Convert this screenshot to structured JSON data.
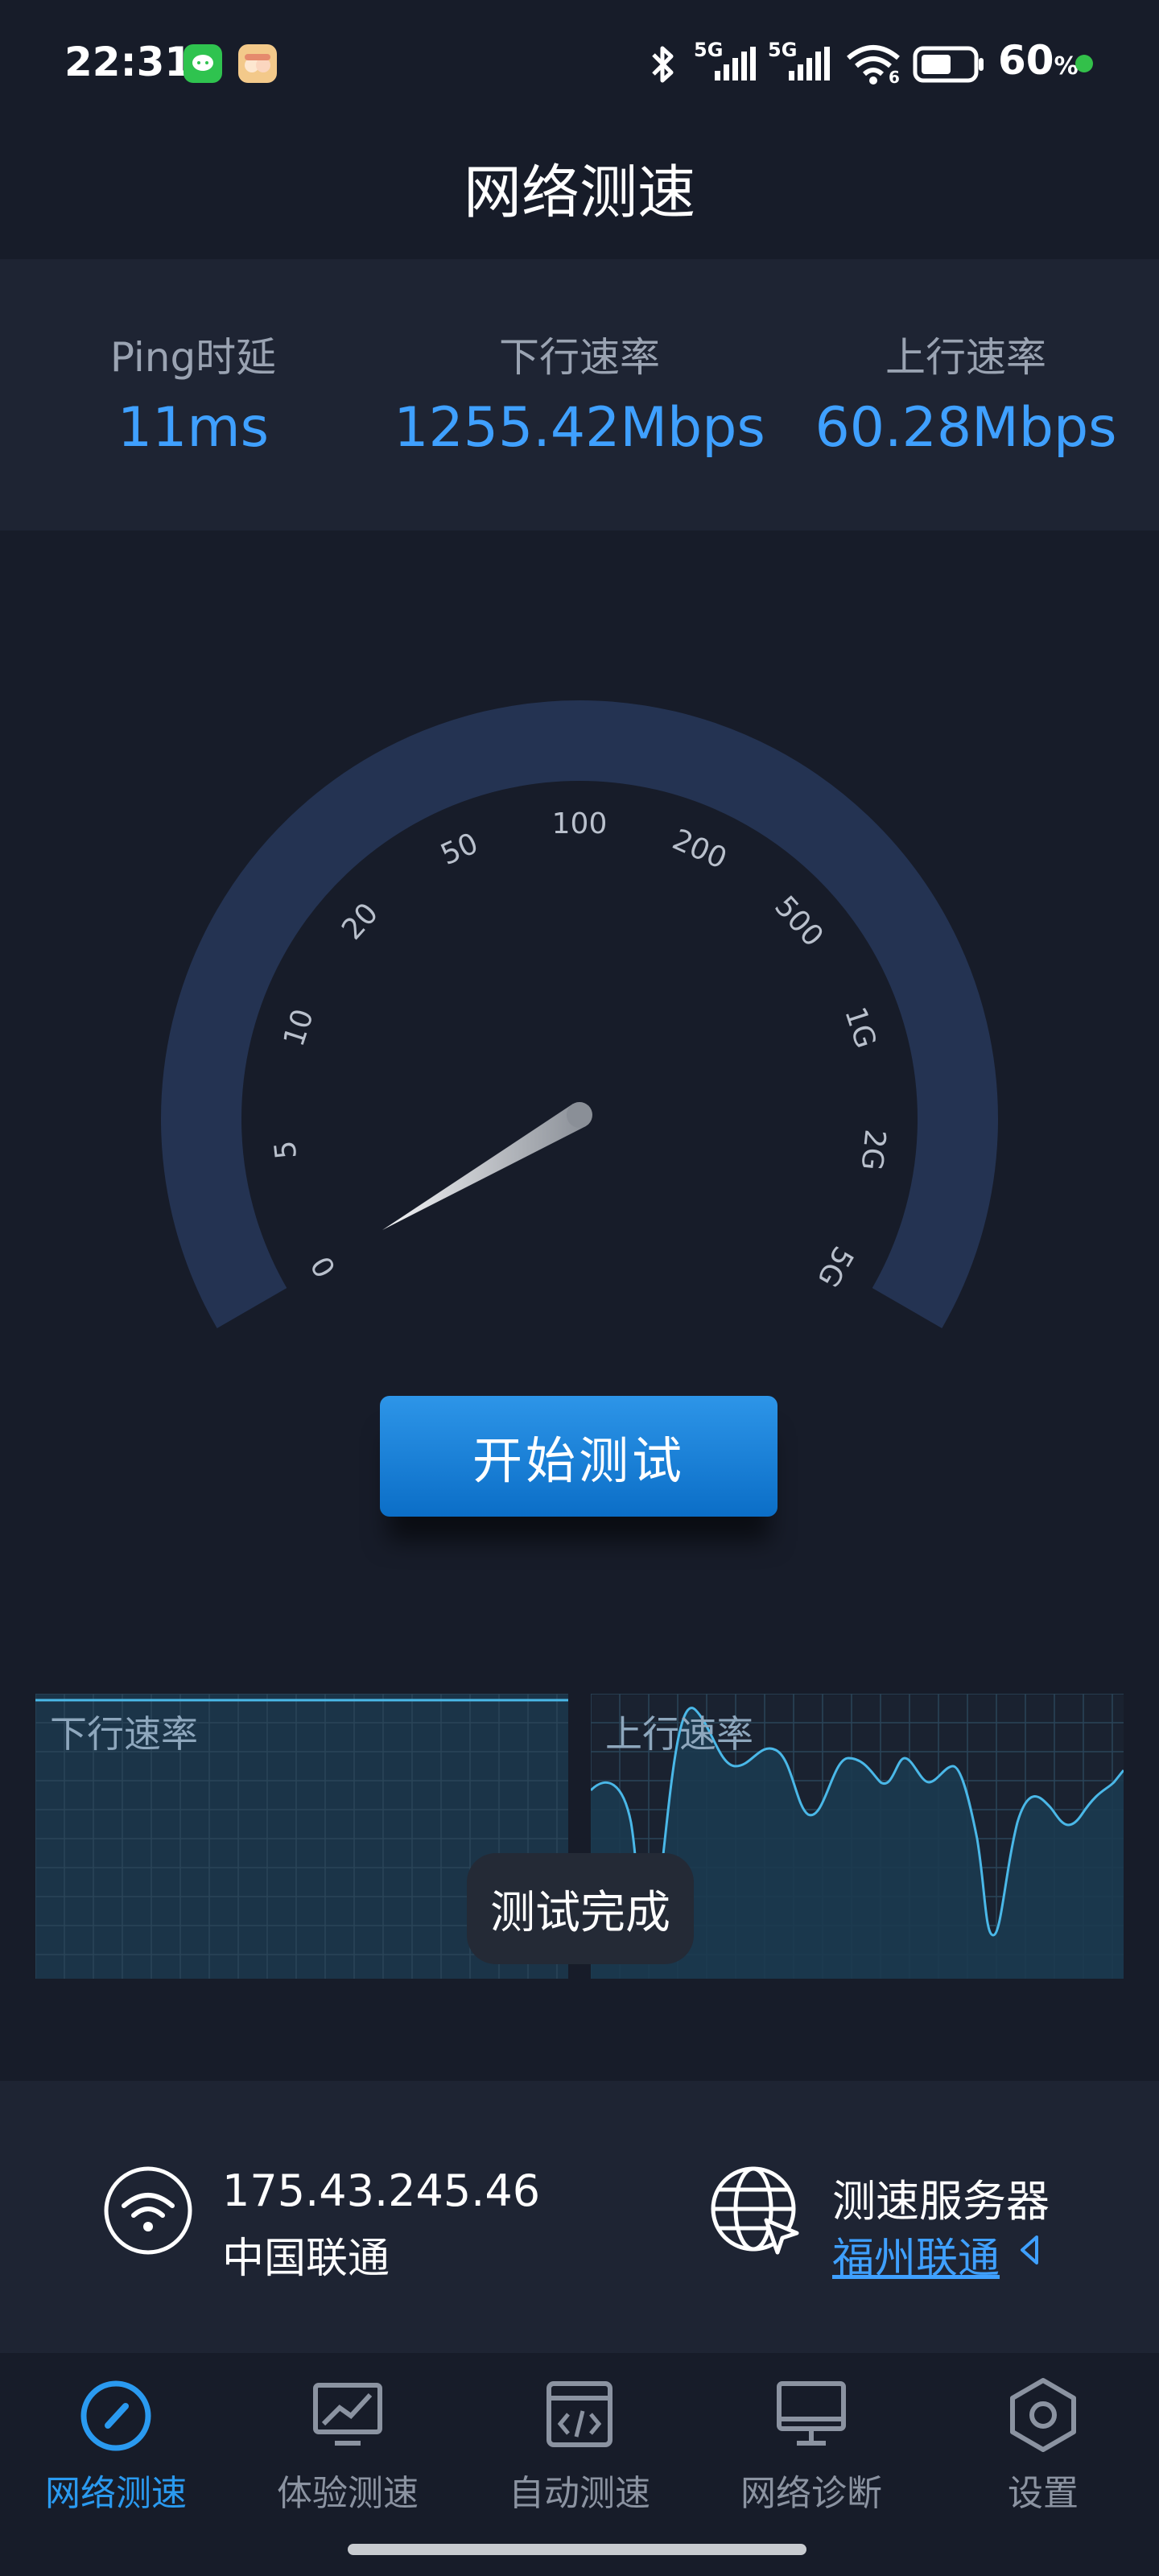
{
  "status_bar": {
    "time": "22:31",
    "battery_percent": "60",
    "battery_unit": "%",
    "net1": "5G",
    "net2": "5G",
    "wifi_sub": "6"
  },
  "title": "网络测速",
  "stats": [
    {
      "label": "Ping时延",
      "value": "11ms"
    },
    {
      "label": "下行速率",
      "value": "1255.42Mbps"
    },
    {
      "label": "上行速率",
      "value": "60.28Mbps"
    }
  ],
  "gauge": {
    "scale_labels": [
      "0",
      "5",
      "10",
      "20",
      "50",
      "100",
      "200",
      "500",
      "1G",
      "2G",
      "5G"
    ],
    "needle_value_fraction": 0.0
  },
  "start_button": "开始测试",
  "charts": {
    "download_label": "下行速率",
    "upload_label": "上行速率"
  },
  "toast": "测试完成",
  "info": {
    "ip": "175.43.245.46",
    "isp": "中国联通",
    "server_title": "测速服务器",
    "server_name": "福州联通"
  },
  "tabs": [
    {
      "label": "网络测速",
      "icon": "speedometer-icon",
      "active": true
    },
    {
      "label": "体验测速",
      "icon": "monitor-chart-icon",
      "active": false
    },
    {
      "label": "自动测速",
      "icon": "code-window-icon",
      "active": false
    },
    {
      "label": "网络诊断",
      "icon": "desktop-icon",
      "active": false
    },
    {
      "label": "设置",
      "icon": "settings-hexagon-icon",
      "active": false
    }
  ],
  "colors": {
    "background": "#171c29",
    "panel": "#1e2433",
    "accent": "#3fa0ff",
    "gauge_ring": "#243352"
  }
}
